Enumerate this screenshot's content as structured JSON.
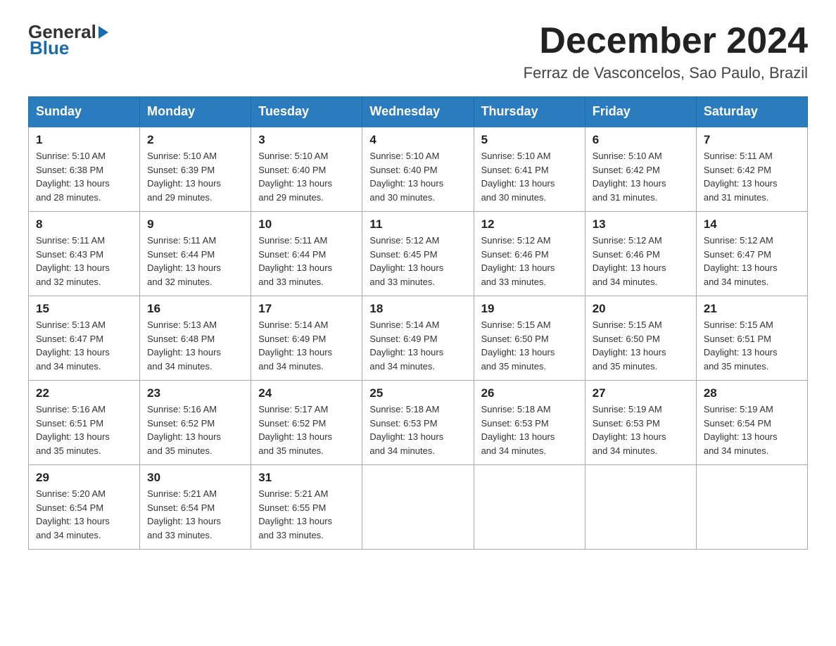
{
  "logo": {
    "general": "General",
    "blue": "Blue"
  },
  "title": {
    "month_year": "December 2024",
    "location": "Ferraz de Vasconcelos, Sao Paulo, Brazil"
  },
  "weekdays": [
    "Sunday",
    "Monday",
    "Tuesday",
    "Wednesday",
    "Thursday",
    "Friday",
    "Saturday"
  ],
  "weeks": [
    [
      {
        "day": "1",
        "sunrise": "5:10 AM",
        "sunset": "6:38 PM",
        "daylight": "13 hours and 28 minutes."
      },
      {
        "day": "2",
        "sunrise": "5:10 AM",
        "sunset": "6:39 PM",
        "daylight": "13 hours and 29 minutes."
      },
      {
        "day": "3",
        "sunrise": "5:10 AM",
        "sunset": "6:40 PM",
        "daylight": "13 hours and 29 minutes."
      },
      {
        "day": "4",
        "sunrise": "5:10 AM",
        "sunset": "6:40 PM",
        "daylight": "13 hours and 30 minutes."
      },
      {
        "day": "5",
        "sunrise": "5:10 AM",
        "sunset": "6:41 PM",
        "daylight": "13 hours and 30 minutes."
      },
      {
        "day": "6",
        "sunrise": "5:10 AM",
        "sunset": "6:42 PM",
        "daylight": "13 hours and 31 minutes."
      },
      {
        "day": "7",
        "sunrise": "5:11 AM",
        "sunset": "6:42 PM",
        "daylight": "13 hours and 31 minutes."
      }
    ],
    [
      {
        "day": "8",
        "sunrise": "5:11 AM",
        "sunset": "6:43 PM",
        "daylight": "13 hours and 32 minutes."
      },
      {
        "day": "9",
        "sunrise": "5:11 AM",
        "sunset": "6:44 PM",
        "daylight": "13 hours and 32 minutes."
      },
      {
        "day": "10",
        "sunrise": "5:11 AM",
        "sunset": "6:44 PM",
        "daylight": "13 hours and 33 minutes."
      },
      {
        "day": "11",
        "sunrise": "5:12 AM",
        "sunset": "6:45 PM",
        "daylight": "13 hours and 33 minutes."
      },
      {
        "day": "12",
        "sunrise": "5:12 AM",
        "sunset": "6:46 PM",
        "daylight": "13 hours and 33 minutes."
      },
      {
        "day": "13",
        "sunrise": "5:12 AM",
        "sunset": "6:46 PM",
        "daylight": "13 hours and 34 minutes."
      },
      {
        "day": "14",
        "sunrise": "5:12 AM",
        "sunset": "6:47 PM",
        "daylight": "13 hours and 34 minutes."
      }
    ],
    [
      {
        "day": "15",
        "sunrise": "5:13 AM",
        "sunset": "6:47 PM",
        "daylight": "13 hours and 34 minutes."
      },
      {
        "day": "16",
        "sunrise": "5:13 AM",
        "sunset": "6:48 PM",
        "daylight": "13 hours and 34 minutes."
      },
      {
        "day": "17",
        "sunrise": "5:14 AM",
        "sunset": "6:49 PM",
        "daylight": "13 hours and 34 minutes."
      },
      {
        "day": "18",
        "sunrise": "5:14 AM",
        "sunset": "6:49 PM",
        "daylight": "13 hours and 34 minutes."
      },
      {
        "day": "19",
        "sunrise": "5:15 AM",
        "sunset": "6:50 PM",
        "daylight": "13 hours and 35 minutes."
      },
      {
        "day": "20",
        "sunrise": "5:15 AM",
        "sunset": "6:50 PM",
        "daylight": "13 hours and 35 minutes."
      },
      {
        "day": "21",
        "sunrise": "5:15 AM",
        "sunset": "6:51 PM",
        "daylight": "13 hours and 35 minutes."
      }
    ],
    [
      {
        "day": "22",
        "sunrise": "5:16 AM",
        "sunset": "6:51 PM",
        "daylight": "13 hours and 35 minutes."
      },
      {
        "day": "23",
        "sunrise": "5:16 AM",
        "sunset": "6:52 PM",
        "daylight": "13 hours and 35 minutes."
      },
      {
        "day": "24",
        "sunrise": "5:17 AM",
        "sunset": "6:52 PM",
        "daylight": "13 hours and 35 minutes."
      },
      {
        "day": "25",
        "sunrise": "5:18 AM",
        "sunset": "6:53 PM",
        "daylight": "13 hours and 34 minutes."
      },
      {
        "day": "26",
        "sunrise": "5:18 AM",
        "sunset": "6:53 PM",
        "daylight": "13 hours and 34 minutes."
      },
      {
        "day": "27",
        "sunrise": "5:19 AM",
        "sunset": "6:53 PM",
        "daylight": "13 hours and 34 minutes."
      },
      {
        "day": "28",
        "sunrise": "5:19 AM",
        "sunset": "6:54 PM",
        "daylight": "13 hours and 34 minutes."
      }
    ],
    [
      {
        "day": "29",
        "sunrise": "5:20 AM",
        "sunset": "6:54 PM",
        "daylight": "13 hours and 34 minutes."
      },
      {
        "day": "30",
        "sunrise": "5:21 AM",
        "sunset": "6:54 PM",
        "daylight": "13 hours and 33 minutes."
      },
      {
        "day": "31",
        "sunrise": "5:21 AM",
        "sunset": "6:55 PM",
        "daylight": "13 hours and 33 minutes."
      },
      null,
      null,
      null,
      null
    ]
  ],
  "labels": {
    "sunrise": "Sunrise:",
    "sunset": "Sunset:",
    "daylight": "Daylight:"
  }
}
